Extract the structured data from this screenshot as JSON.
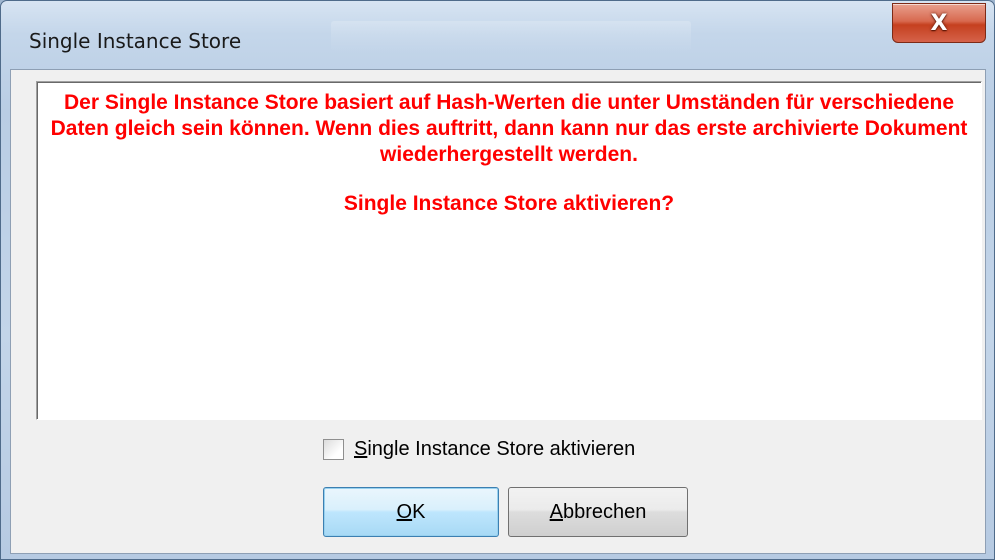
{
  "window": {
    "title": "Single Instance Store",
    "close_glyph": "X"
  },
  "message": {
    "text": "Der Single Instance Store basiert auf Hash-Werten die unter Umständen für verschiedene Daten gleich sein können. Wenn dies auftritt, dann kann nur das erste archivierte Dokument wiederhergestellt werden.",
    "question": "Single Instance Store aktivieren?",
    "color": "#ff0000"
  },
  "checkbox": {
    "mnemonic": "S",
    "label_rest": "ingle Instance Store aktivieren",
    "checked": false
  },
  "buttons": {
    "ok_mnemonic": "O",
    "ok_rest": "K",
    "cancel_mnemonic": "A",
    "cancel_rest": "bbrechen"
  }
}
